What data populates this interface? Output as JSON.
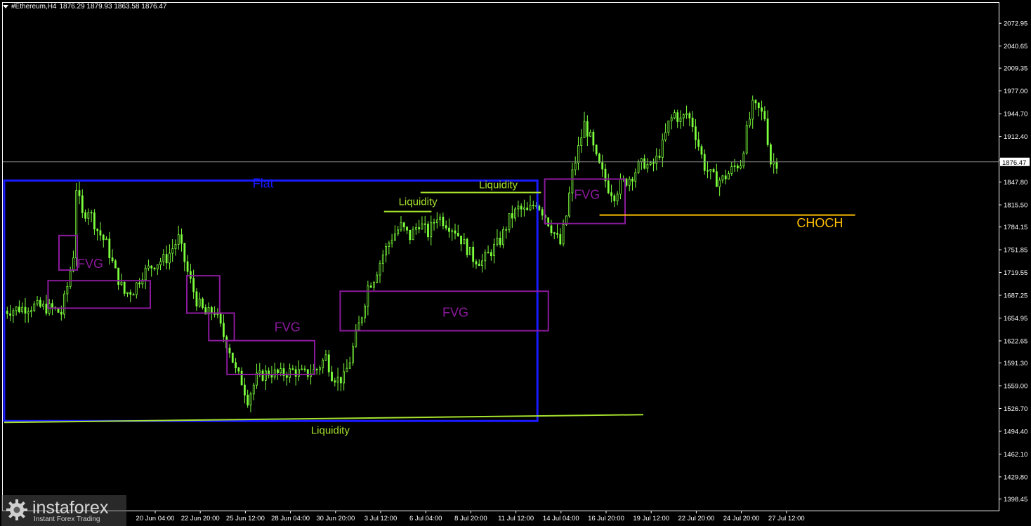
{
  "header": {
    "symbol": "#Ethereum,H4",
    "ohlc": "1876.29 1879.93 1863.58 1876.47"
  },
  "logo": {
    "name": "instaforex",
    "tagline": "Instant Forex Trading"
  },
  "colors": {
    "background": "#000000",
    "candle": "#7cff3c",
    "flat_box": "#1a1aff",
    "fvg_box": "#8b1a9c",
    "liquidity": "#a6e22e",
    "choch": "#ffc000",
    "axis": "#ffffff",
    "price_line": "#8c8c8c"
  },
  "chart_data": {
    "type": "candlestick",
    "symbol": "#Ethereum",
    "timeframe": "H4",
    "current_price": 1876.47,
    "ylim": [
      1382,
      2102
    ],
    "y_ticks": [
      "2072.95",
      "2040.65",
      "2009.35",
      "1977.00",
      "1944.70",
      "1912.40",
      "1879.10",
      "1847.80",
      "1815.50",
      "1784.15",
      "1751.85",
      "1719.55",
      "1687.25",
      "1654.95",
      "1622.65",
      "1591.30",
      "1559.00",
      "1526.70",
      "1494.40",
      "1462.10",
      "1429.80",
      "1398.45"
    ],
    "x_ticks": [
      "20 Jun 04:00",
      "22 Jun 20:00",
      "25 Jun 12:00",
      "28 Jun 04:00",
      "30 Jun 20:00",
      "3 Jul 12:00",
      "6 Jul 04:00",
      "8 Jul 20:00",
      "11 Jul 12:00",
      "14 Jul 04:00",
      "16 Jul 20:00",
      "19 Jul 12:00",
      "22 Jul 20:00",
      "24 Jul 20:00",
      "27 Jul 12:00"
    ],
    "x_range": {
      "start_index": 0,
      "end_index": 255
    },
    "price_path": [
      [
        0,
        1665
      ],
      [
        8,
        1672
      ],
      [
        16,
        1676
      ],
      [
        24,
        1668
      ],
      [
        30,
        1660
      ],
      [
        34,
        1700
      ],
      [
        38,
        1740
      ],
      [
        41,
        1760
      ],
      [
        43,
        1835
      ],
      [
        46,
        1815
      ],
      [
        50,
        1790
      ],
      [
        54,
        1805
      ],
      [
        58,
        1780
      ],
      [
        62,
        1755
      ],
      [
        66,
        1745
      ],
      [
        70,
        1720
      ],
      [
        74,
        1700
      ],
      [
        78,
        1688
      ],
      [
        82,
        1690
      ],
      [
        86,
        1700
      ],
      [
        90,
        1710
      ],
      [
        94,
        1725
      ],
      [
        98,
        1738
      ],
      [
        102,
        1730
      ],
      [
        106,
        1735
      ],
      [
        110,
        1745
      ],
      [
        114,
        1755
      ],
      [
        118,
        1740
      ],
      [
        122,
        1720
      ],
      [
        125,
        1690
      ],
      [
        128,
        1660
      ],
      [
        131,
        1650
      ],
      [
        134,
        1668
      ],
      [
        137,
        1665
      ],
      [
        140,
        1650
      ],
      [
        144,
        1630
      ],
      [
        147,
        1618
      ],
      [
        150,
        1592
      ],
      [
        153,
        1575
      ],
      [
        156,
        1560
      ],
      [
        159,
        1545
      ],
      [
        162,
        1562
      ],
      [
        165,
        1575
      ],
      [
        168,
        1578
      ],
      [
        172,
        1585
      ],
      [
        176,
        1580
      ],
      [
        180,
        1578
      ],
      [
        184,
        1575
      ],
      [
        188,
        1580
      ],
      [
        192,
        1586
      ],
      [
        196,
        1570
      ],
      [
        199,
        1575
      ],
      [
        202,
        1568
      ],
      [
        205,
        1572
      ],
      [
        208,
        1575
      ],
      [
        211,
        1590
      ],
      [
        214,
        1605
      ],
      [
        217,
        1620
      ],
      [
        220,
        1640
      ],
      [
        223,
        1660
      ],
      [
        226,
        1690
      ],
      [
        229,
        1710
      ],
      [
        232,
        1722
      ],
      [
        235,
        1740
      ],
      [
        238,
        1752
      ],
      [
        241,
        1760
      ],
      [
        244,
        1765
      ],
      [
        247,
        1772
      ],
      [
        250,
        1778
      ],
      [
        253,
        1784
      ]
    ],
    "candle_count": 255,
    "annotations": [
      {
        "kind": "rect",
        "label": "Flat",
        "color": "flat_box",
        "x1": 0,
        "x2": 146,
        "y1": 1509,
        "y2": 1850,
        "label_at": [
          68,
          1840
        ]
      },
      {
        "kind": "rect",
        "label": "FVG",
        "color": "fvg_box",
        "x1": 15,
        "x2": 20,
        "y1": 1723,
        "y2": 1772,
        "label_at": [
          20,
          1726
        ]
      },
      {
        "kind": "rect",
        "label": "",
        "color": "fvg_box",
        "x1": 12,
        "x2": 40,
        "y1": 1669,
        "y2": 1708
      },
      {
        "kind": "rect",
        "label": "",
        "color": "fvg_box",
        "x1": 50,
        "x2": 59,
        "y1": 1662,
        "y2": 1715
      },
      {
        "kind": "rect",
        "label": "FVG",
        "color": "fvg_box",
        "x1": 56,
        "x2": 63,
        "y1": 1623,
        "y2": 1662,
        "label_at": [
          74,
          1636
        ]
      },
      {
        "kind": "rect",
        "label": "",
        "color": "fvg_box",
        "x1": 61,
        "x2": 85,
        "y1": 1575,
        "y2": 1623
      },
      {
        "kind": "rect",
        "label": "FVG",
        "color": "fvg_box",
        "x1": 92,
        "x2": 149,
        "y1": 1637,
        "y2": 1693,
        "label_at": [
          120,
          1657
        ]
      },
      {
        "kind": "rect",
        "label": "FVG",
        "color": "fvg_box",
        "x1": 148,
        "x2": 170,
        "y1": 1789,
        "y2": 1852,
        "label_at": [
          156,
          1824
        ]
      },
      {
        "kind": "line",
        "label": "Liquidity",
        "color": "liquidity",
        "x1": 104,
        "x2": 117,
        "y1": 1806,
        "y2": 1806,
        "label_at": [
          108,
          1815
        ]
      },
      {
        "kind": "line",
        "label": "Liquidity",
        "color": "liquidity",
        "x1": 114,
        "x2": 147,
        "y1": 1833,
        "y2": 1833,
        "label_at": [
          130,
          1839
        ]
      },
      {
        "kind": "line",
        "label": "Liquidity",
        "color": "liquidity",
        "x1": 0,
        "x2": 175,
        "y1": 1507,
        "y2": 1518,
        "label_at": [
          84,
          1491
        ]
      },
      {
        "kind": "line",
        "label": "CHOCH",
        "color": "choch",
        "x1": 163,
        "x2": 233,
        "y1": 1801,
        "y2": 1801,
        "label_at": [
          217,
          1784
        ]
      }
    ]
  }
}
